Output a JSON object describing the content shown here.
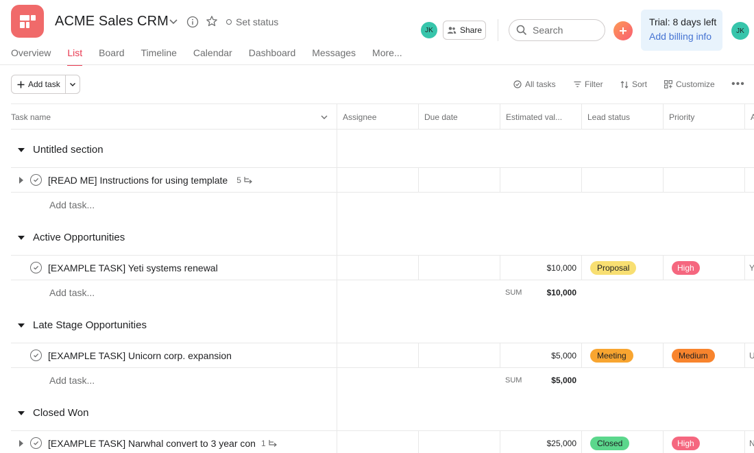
{
  "header": {
    "project_title": "ACME Sales CRM",
    "set_status": "Set status",
    "avatar_initials": "JK",
    "share_label": "Share",
    "search_placeholder": "Search",
    "trial_text": "Trial: 8 days left",
    "billing_link": "Add billing info"
  },
  "tabs": [
    "Overview",
    "List",
    "Board",
    "Timeline",
    "Calendar",
    "Dashboard",
    "Messages",
    "More..."
  ],
  "active_tab": "List",
  "toolbar": {
    "add_task": "Add task",
    "all_tasks": "All tasks",
    "filter": "Filter",
    "sort": "Sort",
    "customize": "Customize"
  },
  "columns": {
    "task_name": "Task name",
    "assignee": "Assignee",
    "due_date": "Due date",
    "estimated_value": "Estimated val...",
    "lead_status": "Lead status",
    "priority": "Priority",
    "truncated": "A"
  },
  "sections": [
    {
      "title": "Untitled section",
      "tasks": [
        {
          "name": "[READ ME] Instructions for using template",
          "subtasks": "5",
          "value": "",
          "lead_status": "",
          "priority": "",
          "extra": ""
        }
      ],
      "add_task": "Add task...",
      "sum_label": "",
      "sum_value": ""
    },
    {
      "title": "Active Opportunities",
      "tasks": [
        {
          "name": "[EXAMPLE TASK] Yeti systems renewal",
          "subtasks": "",
          "value": "$10,000",
          "lead_status": "Proposal",
          "priority": "High",
          "extra": "Y"
        }
      ],
      "add_task": "Add task...",
      "sum_label": "SUM",
      "sum_value": "$10,000"
    },
    {
      "title": "Late Stage Opportunities",
      "tasks": [
        {
          "name": "[EXAMPLE TASK] Unicorn corp. expansion",
          "subtasks": "",
          "value": "$5,000",
          "lead_status": "Meeting",
          "priority": "Medium",
          "extra": "U"
        }
      ],
      "add_task": "Add task...",
      "sum_label": "SUM",
      "sum_value": "$5,000"
    },
    {
      "title": "Closed Won",
      "tasks": [
        {
          "name": "[EXAMPLE TASK] Narwhal convert to 3 year con",
          "subtasks": "1",
          "value": "$25,000",
          "lead_status": "Closed",
          "priority": "High",
          "extra": "N"
        }
      ],
      "add_task": "",
      "sum_label": "",
      "sum_value": ""
    }
  ],
  "colors": {
    "accent": "#e8384f",
    "proposal": "#f8df72",
    "meeting": "#f8a530",
    "closed": "#5bd78c",
    "high": "#f5677f",
    "medium": "#f8842d"
  }
}
